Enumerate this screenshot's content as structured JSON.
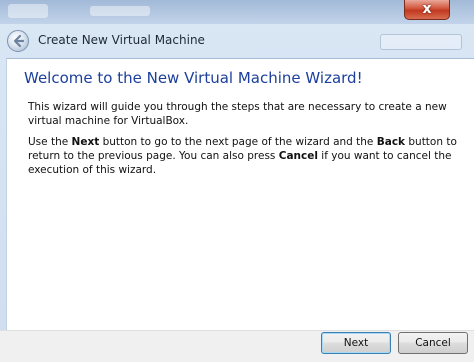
{
  "window": {
    "title": "Create New Virtual Machine",
    "close_glyph": "x"
  },
  "wizard": {
    "heading": "Welcome to the New Virtual Machine Wizard!",
    "intro": "This wizard will guide you through the steps that are necessary to create a new virtual machine for VirtualBox.",
    "instructions": {
      "part1": "Use the ",
      "next_word": "Next",
      "part2": " button to go to the next page of the wizard and the ",
      "back_word": "Back",
      "part3": " button to return to the previous page. You can also press ",
      "cancel_word": "Cancel",
      "part4": " if you want to cancel the execution of this wizard."
    }
  },
  "buttons": {
    "next_label": "Next",
    "cancel_label": "Cancel"
  },
  "icons": {
    "back": "back-arrow-icon",
    "close": "close-icon"
  },
  "colors": {
    "heading": "#1b3f9b",
    "close_button": "#c0391f",
    "default_button_border": "#3c7fb1"
  }
}
